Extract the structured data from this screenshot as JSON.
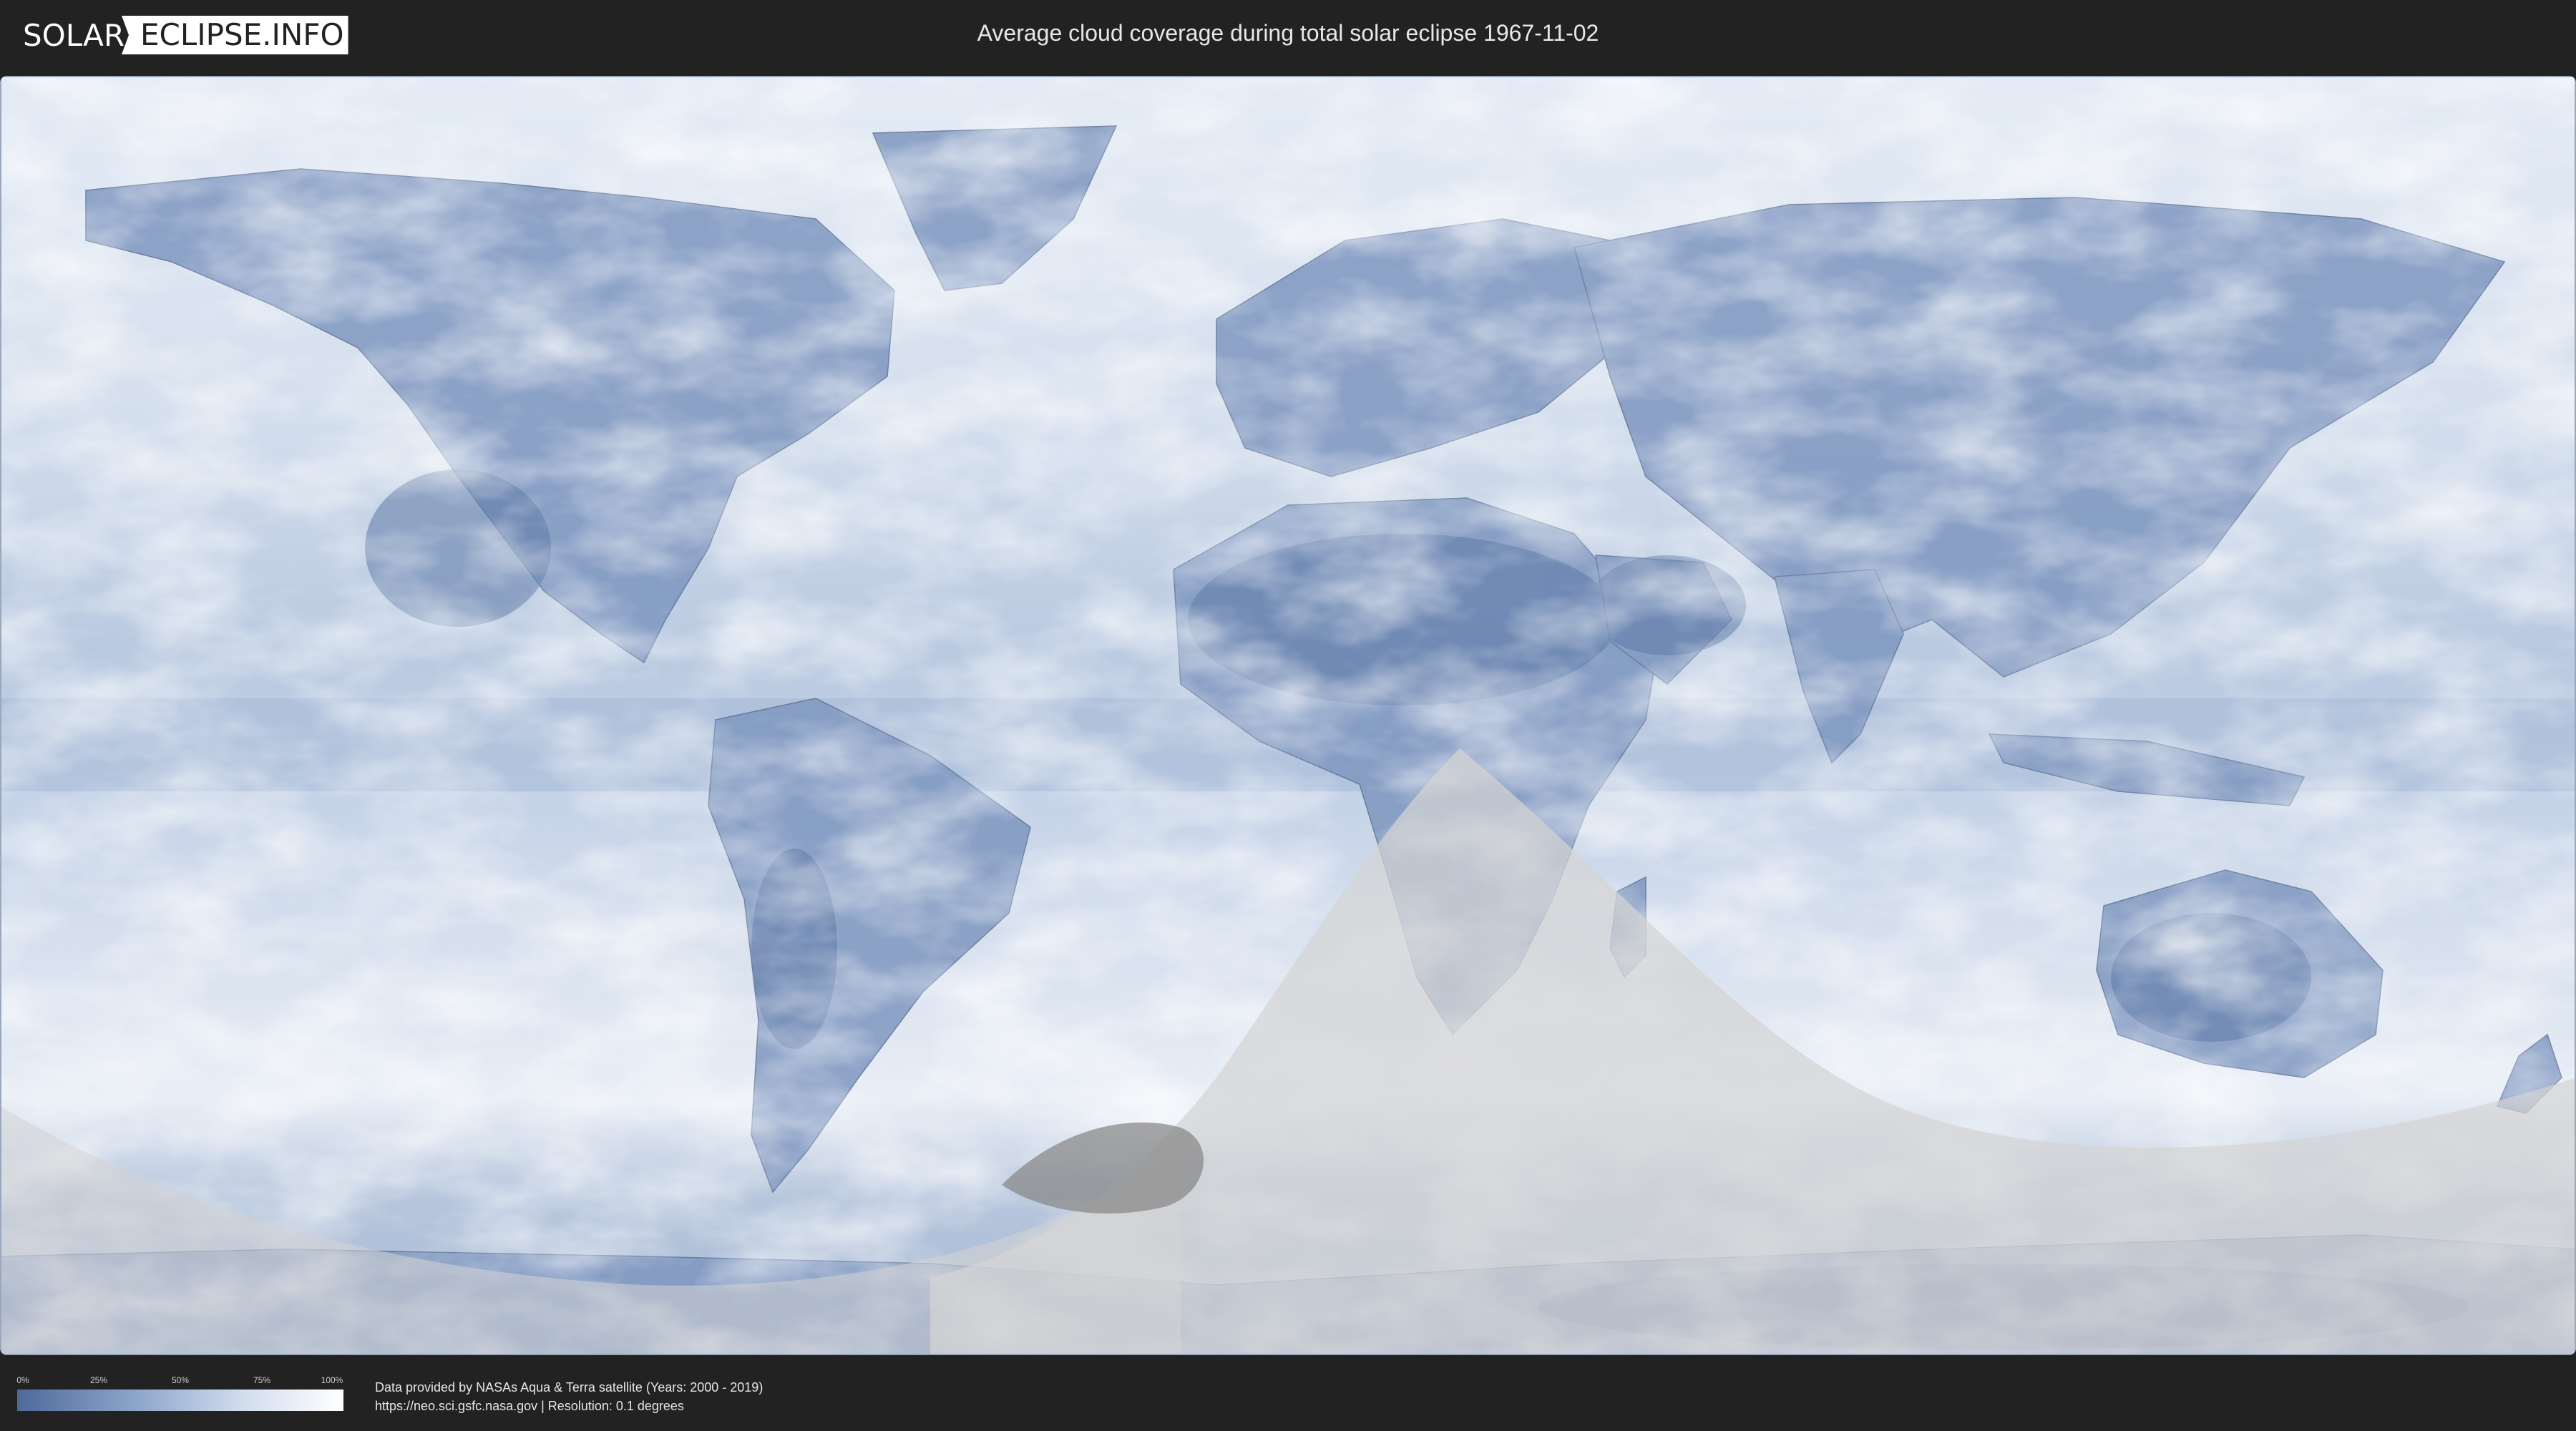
{
  "header": {
    "logo_left": "SOLAR",
    "logo_right": "ECLIPSE.INFO",
    "title": "Average cloud coverage during total solar eclipse 1967-11-02"
  },
  "legend": {
    "ticks": [
      "0%",
      "25%",
      "50%",
      "75%",
      "100%"
    ],
    "gradient_colors": [
      "#4f6a9a",
      "#8aa3c8",
      "#d3deee",
      "#ffffff"
    ]
  },
  "credits": {
    "line1": "Data provided by NASAs Aqua & Terra satellite (Years: 2000 - 2019)",
    "line2": "https://neo.sci.gsfc.nasa.gov | Resolution: 0.1 degrees"
  },
  "colors": {
    "background": "#222222",
    "ocean_cloud": "#cdd9ea",
    "clear_sky": "#5f7aa8",
    "night_overlay": "#d4d4d4",
    "totality_path": "#8a8a8a"
  }
}
